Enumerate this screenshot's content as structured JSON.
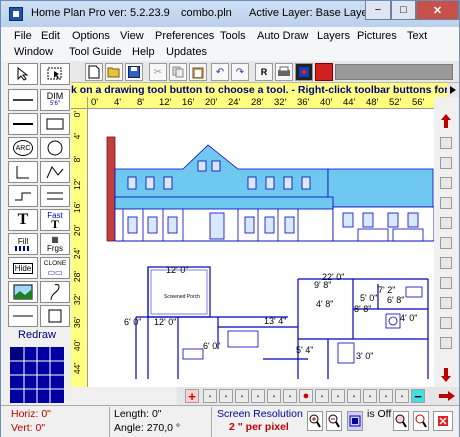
{
  "titlebar": {
    "app_title": "Home Plan Pro ver: 5.2.23.9",
    "file_name": "combo.pln",
    "active_layer": "Active Layer: Base Layer",
    "minimize": "−",
    "maximize": "□",
    "close": "✕"
  },
  "menu": [
    "File",
    "Edit",
    "Options",
    "View",
    "Preferences",
    "Tools",
    "Auto Draw",
    "Layers",
    "Pictures",
    "Text",
    "Window",
    "Tool Guide",
    "Help",
    "Updates"
  ],
  "hint_text": "k on a drawing tool button to choose a tool.  -  Right-click toolbar buttons for",
  "ruler_top": [
    "0'",
    "4'",
    "8'",
    "12'",
    "16'",
    "20'",
    "24'",
    "28'",
    "32'",
    "36'",
    "40'",
    "44'",
    "48'",
    "52'",
    "56'"
  ],
  "ruler_left": [
    "0'",
    "4'",
    "8'",
    "12'",
    "16'",
    "20'",
    "24'",
    "28'",
    "32'",
    "36'",
    "40'",
    "44'"
  ],
  "tools": {
    "dim_label": "DIM",
    "dim_sub": "5'6\"",
    "arc_label": "ARC",
    "fast_label": "Fast",
    "fill_label": "Fill",
    "fill_sub": "Frgs",
    "hide_label": "Hide",
    "clone_label": "CLONE",
    "redraw_label": "Redraw"
  },
  "plan_labels": {
    "d12_0_top": "12' 0\"",
    "d22_0": "22' 0\"",
    "d9_8": "9' 8\"",
    "d7_2": "7' 2\"",
    "d4_8": "4' 8\"",
    "d5_0": "5' 0\"",
    "d6_0": "6' 0\"",
    "d12_0_mid": "12' 0\"",
    "d13_4": "13' 4\"",
    "d8_8": "8' 8\"",
    "d6_8": "6' 8\"",
    "d3_0": "3' 0\"",
    "d4_0": "4' 0\"",
    "d5_4": "5' 4\"",
    "d6_0b": "6' 0\"",
    "room_label": "Screened Porch"
  },
  "nav": {
    "plus": "+",
    "minus": "−"
  },
  "status": {
    "horiz": "Horiz: 0\"",
    "vert": "Vert: 0\"",
    "length": "Length:  0\"",
    "angle": "Angle:  270,0 °",
    "screen_res": "Screen Resolution",
    "per_pixel": "2 \" per pixel",
    "is_off": "is Off"
  },
  "colors": {
    "accent": "#0000a0",
    "hint_bg": "#ffff80",
    "plan": "#0000c0",
    "roof": "#6ec8f0",
    "chimney": "#a02020",
    "status_red": "#c00000"
  }
}
